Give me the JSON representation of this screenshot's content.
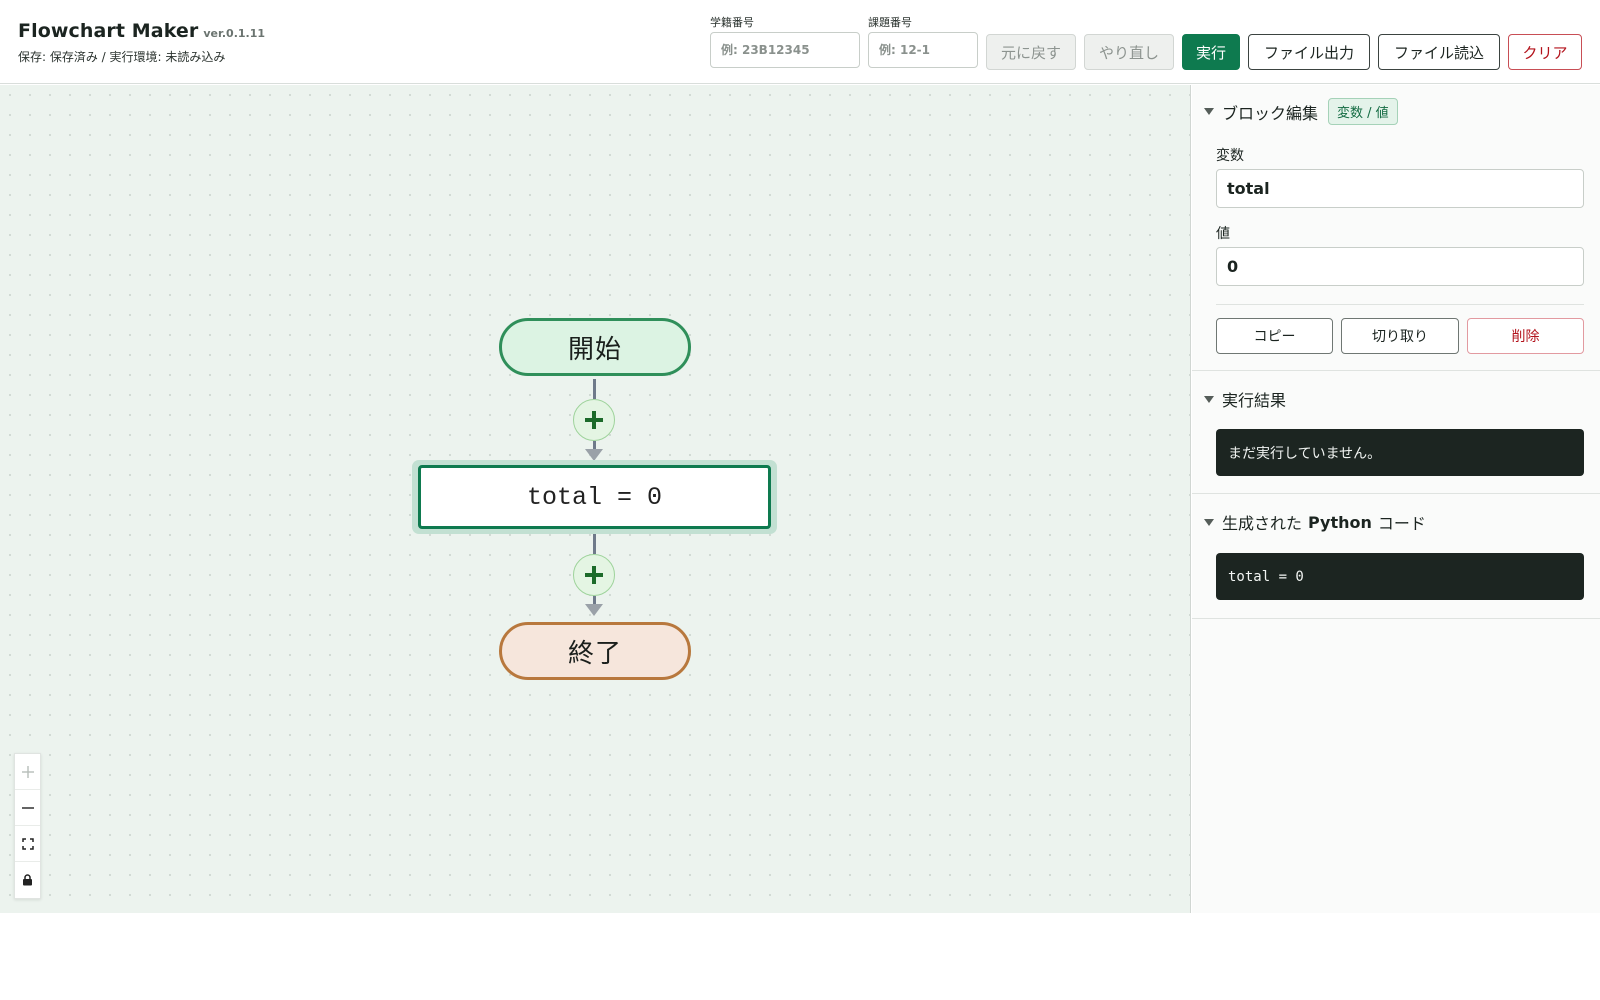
{
  "app": {
    "title": "Flowchart Maker",
    "version": "ver.0.1.11",
    "status": "保存: 保存済み / 実行環境: 未読み込み"
  },
  "header": {
    "student_id": {
      "label": "学籍番号",
      "placeholder": "例: 23B12345",
      "value": ""
    },
    "assignment_id": {
      "label": "課題番号",
      "placeholder": "例: 12-1",
      "value": ""
    },
    "buttons": {
      "undo": "元に戻す",
      "redo": "やり直し",
      "run": "実行",
      "export": "ファイル出力",
      "import": "ファイル読込",
      "clear": "クリア"
    }
  },
  "flowchart": {
    "start_label": "開始",
    "process_label": "total = 0",
    "end_label": "終了",
    "add_symbol": "+"
  },
  "zoom": {
    "zoom_in": "+",
    "zoom_out": "—",
    "fit": "⛶",
    "lock": "🔒"
  },
  "panel": {
    "block_edit": {
      "title": "ブロック編集",
      "badge": "変数 / 値",
      "variable_label": "変数",
      "variable_value": "total",
      "value_label": "値",
      "value_value": "0",
      "copy": "コピー",
      "cut": "切り取り",
      "delete": "削除"
    },
    "result": {
      "title": "実行結果",
      "output": "まだ実行していません。"
    },
    "python": {
      "title_prefix": "生成された",
      "title_bold": "Python",
      "title_suffix": "コード",
      "code": "total = 0"
    }
  },
  "colors": {
    "primary": "#0e7a4f",
    "danger": "#b3121b",
    "start_fill": "#dcf3e3",
    "start_border": "#2f8f5a",
    "end_fill": "#f6e6dc",
    "end_border": "#b8783d",
    "canvas_bg": "#ecf3ee",
    "console_bg": "#1c2521"
  },
  "icons": {
    "collapse": "caret-down-icon",
    "add": "plus-icon",
    "fit": "fit-view-icon",
    "lock": "lock-icon"
  }
}
